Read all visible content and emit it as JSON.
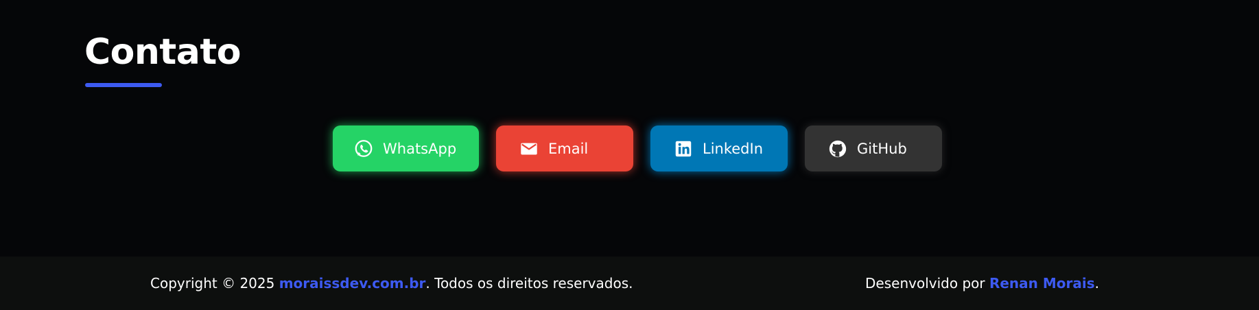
{
  "contact": {
    "title": "Contato",
    "accent_color": "#3d5af1",
    "buttons": [
      {
        "label": "WhatsApp",
        "icon": "whatsapp-icon",
        "color": "#25d366"
      },
      {
        "label": "Email",
        "icon": "email-icon",
        "color": "#ea4335"
      },
      {
        "label": "LinkedIn",
        "icon": "linkedin-icon",
        "color": "#0077b5"
      },
      {
        "label": "GitHub",
        "icon": "github-icon",
        "color": "#333333"
      }
    ]
  },
  "footer": {
    "copyright_prefix": "Copyright © 2025 ",
    "site_link": "moraissdev.com.br",
    "copyright_suffix": ". Todos os direitos reservados.",
    "developed_prefix": "Desenvolvido por ",
    "author_link": "Renan Morais",
    "developed_suffix": "."
  }
}
